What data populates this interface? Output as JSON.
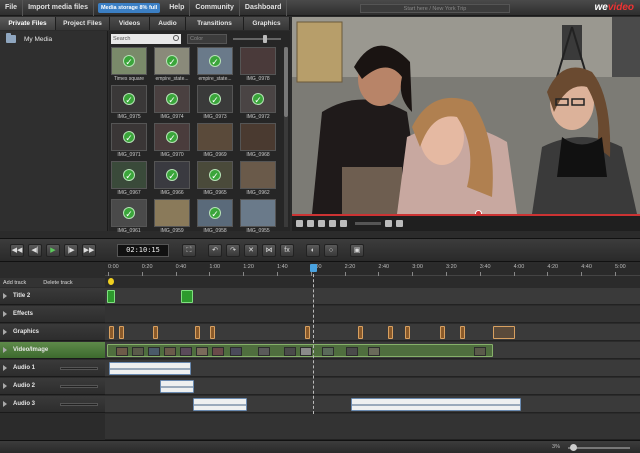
{
  "menu": {
    "items": [
      "File",
      "Import media files"
    ],
    "storage_badge": "Media storage 8% full",
    "items_right": [
      "Help",
      "Community",
      "Dashboard"
    ],
    "project_title": "Start here / New York Trip",
    "brand_we": "we",
    "brand_video": "video"
  },
  "tabs": [
    "Private Files",
    "Project Files",
    "Videos",
    "Audio",
    "Transitions",
    "Graphics"
  ],
  "folders": {
    "my_media": "My Media"
  },
  "search": {
    "placeholder": "Search",
    "color_label": "Color"
  },
  "thumbnails": [
    {
      "label": "Times square",
      "checked": true,
      "color": "#7a8a6a"
    },
    {
      "label": "empire_state...",
      "checked": true,
      "color": "#8a8a7a"
    },
    {
      "label": "empire_state...",
      "checked": true,
      "color": "#6a7a8a"
    },
    {
      "label": "IMG_0978",
      "checked": false,
      "color": "#4a3a3a"
    },
    {
      "label": "IMG_0975",
      "checked": true,
      "color": "#3a3838"
    },
    {
      "label": "IMG_0974",
      "checked": true,
      "color": "#4a4040"
    },
    {
      "label": "IMG_0973",
      "checked": true,
      "color": "#3a3a3a"
    },
    {
      "label": "IMG_0972",
      "checked": true,
      "color": "#4a4444"
    },
    {
      "label": "IMG_0971",
      "checked": true,
      "color": "#3a3636"
    },
    {
      "label": "IMG_0970",
      "checked": true,
      "color": "#4a3c3c"
    },
    {
      "label": "IMG_0969",
      "checked": false,
      "color": "#5a4a3a"
    },
    {
      "label": "IMG_0968",
      "checked": false,
      "color": "#4a3a30"
    },
    {
      "label": "IMG_0967",
      "checked": true,
      "color": "#3a4a3a"
    },
    {
      "label": "IMG_0966",
      "checked": true,
      "color": "#3a3a40"
    },
    {
      "label": "IMG_0965",
      "checked": true,
      "color": "#4a4a3a"
    },
    {
      "label": "IMG_0962",
      "checked": false,
      "color": "#6a5a4a"
    },
    {
      "label": "IMG_0961",
      "checked": true,
      "color": "#4a4a4a"
    },
    {
      "label": "IMG_0959",
      "checked": false,
      "color": "#8a7a5a"
    },
    {
      "label": "IMG_0958",
      "checked": true,
      "color": "#5a6a7a"
    },
    {
      "label": "IMG_0955",
      "checked": false,
      "color": "#6a7a8a"
    }
  ],
  "transport": {
    "timecode": "02:10:15"
  },
  "ruler": [
    "0:00",
    "0:20",
    "0:40",
    "1:00",
    "1:20",
    "1:40",
    "2:00",
    "2:20",
    "2:40",
    "3:00",
    "3:20",
    "3:40",
    "4:00",
    "4:20",
    "4:40",
    "5:00"
  ],
  "track_header": {
    "add_track": "Add track",
    "delete_track": "Delete track"
  },
  "tracks": [
    {
      "label": "Title 2"
    },
    {
      "label": "Effects"
    },
    {
      "label": "Graphics"
    },
    {
      "label": "Video/Image"
    },
    {
      "label": "Audio 1"
    },
    {
      "label": "Audio 2"
    },
    {
      "label": "Audio 3"
    }
  ],
  "status": {
    "zoom": "3%"
  },
  "colors": {
    "accent": "#3b7fc4",
    "scrubber": "#cc3333",
    "clip_green": "#2d9a2d",
    "playhead": "#4aa3e0"
  }
}
